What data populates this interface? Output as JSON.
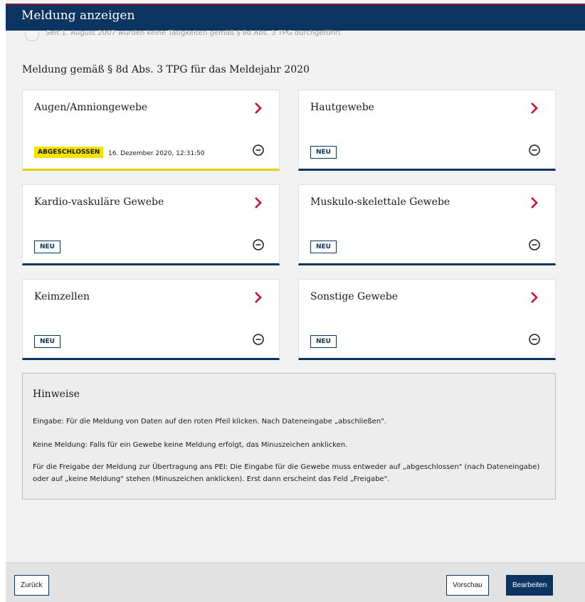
{
  "dialog": {
    "title": "Meldung anzeigen",
    "faded_option_text": "Seit 1. August 2007 wurden keine Tätigkeiten gemäß § 8d Abs. 3 TPG durchgeführt"
  },
  "section": {
    "heading": "Meldung gemäß § 8d Abs. 3 TPG für das Meldejahr 2020"
  },
  "cards": [
    {
      "title": "Augen/Amniongewebe",
      "status": "ABGESCHLOSSEN",
      "timestamp": "16. Dezember 2020, 12:31:50"
    },
    {
      "title": "Hautgewebe",
      "status": "NEU"
    },
    {
      "title": "Kardio-vaskuläre Gewebe",
      "status": "NEU"
    },
    {
      "title": "Muskulo-skelettale Gewebe",
      "status": "NEU"
    },
    {
      "title": "Keimzellen",
      "status": "NEU"
    },
    {
      "title": "Sonstige Gewebe",
      "status": "NEU"
    }
  ],
  "hints": {
    "title": "Hinweise",
    "line1": "Eingabe: Für die Meldung von Daten auf den roten Pfeil klicken. Nach Dateneingabe „abschließen\".",
    "line2": "Keine Meldung: Falls für ein Gewebe keine Meldung erfolgt, das Minuszeichen anklicken.",
    "line3": "Für die Freigabe der Meldung zur Übertragung ans PEI: Die Eingabe für die Gewebe muss entweder auf „abgeschlossen\" (nach Dateneingabe) oder auf „keine Meldung\" stehen (Minuszeichen anklicken). Erst dann erscheint das Feld „Freigabe\"."
  },
  "footer": {
    "back_label": "Zurück",
    "preview_label": "Vorschau",
    "edit_label": "Bearbeiten"
  },
  "colors": {
    "navy": "#0b3460",
    "accent_red": "#c8102e",
    "done_yellow": "#f1e400"
  },
  "icons": {
    "arrow": "chevron-right-icon",
    "minus": "minus-circle-icon"
  }
}
